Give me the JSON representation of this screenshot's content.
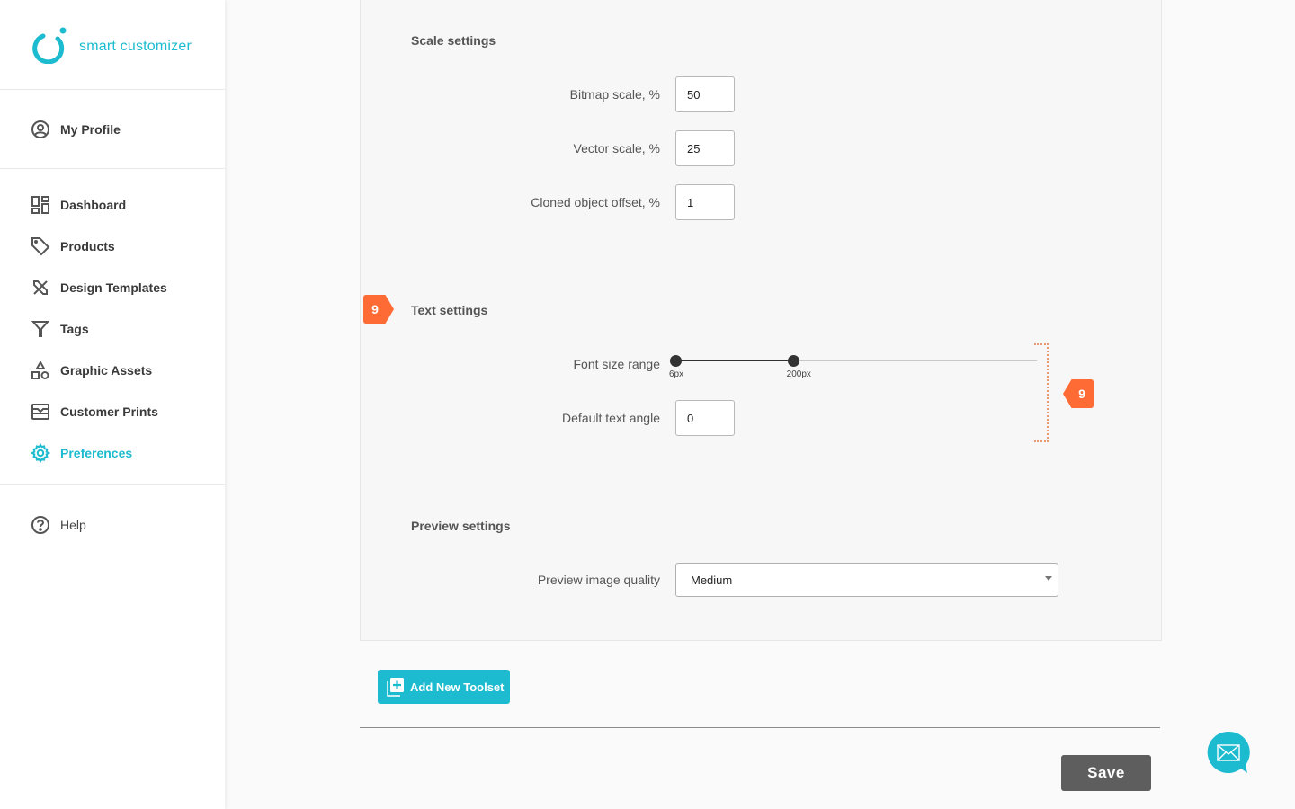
{
  "brand": {
    "name": "smart customizer",
    "accent_color": "#1dbbcf"
  },
  "sidebar": {
    "profile": {
      "label": "My Profile",
      "icon": "user-circle-icon"
    },
    "items": [
      {
        "label": "Dashboard",
        "icon": "dashboard-icon",
        "active": false
      },
      {
        "label": "Products",
        "icon": "tag-icon",
        "active": false
      },
      {
        "label": "Design Templates",
        "icon": "design-tools-icon",
        "active": false
      },
      {
        "label": "Tags",
        "icon": "filter-icon",
        "active": false
      },
      {
        "label": "Graphic Assets",
        "icon": "shapes-icon",
        "active": false
      },
      {
        "label": "Customer Prints",
        "icon": "prints-icon",
        "active": false
      },
      {
        "label": "Preferences",
        "icon": "gear-icon",
        "active": true
      }
    ],
    "help": {
      "label": "Help",
      "icon": "question-circle-icon"
    }
  },
  "scale_settings": {
    "title": "Scale settings",
    "fields": [
      {
        "label": "Bitmap scale, %",
        "value": "50"
      },
      {
        "label": "Vector scale, %",
        "value": "25"
      },
      {
        "label": "Cloned object offset, %",
        "value": "1"
      }
    ]
  },
  "text_settings": {
    "title": "Text settings",
    "font_size_range": {
      "label": "Font size range",
      "min_label": "6px",
      "max_label": "200px",
      "low_fraction": 0,
      "high_fraction": 0.325
    },
    "default_angle": {
      "label": "Default text angle",
      "value": "0"
    }
  },
  "preview_settings": {
    "title": "Preview settings",
    "quality": {
      "label": "Preview image quality",
      "selected": "Medium"
    }
  },
  "annotations": {
    "badge_left": "9",
    "badge_right": "9",
    "color": "#ff6b35"
  },
  "actions": {
    "add_toolset": "Add New Toolset",
    "save": "Save"
  }
}
